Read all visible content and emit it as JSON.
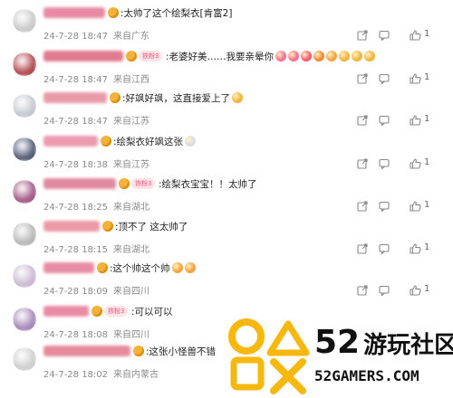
{
  "comments": [
    {
      "text": ":太帅了这个绘梨衣[肯富2]",
      "date": "24-7-28 18:47",
      "location": "来自广东",
      "likes": "1",
      "uname_width": 68,
      "uname_color": "#e88aa3",
      "avatar_color": "#c9c9c9",
      "badge": false,
      "emojis": []
    },
    {
      "text": ":老婆好美……我要亲晕你",
      "date": "24-7-28 18:47",
      "location": "来自江西",
      "likes": "1",
      "uname_width": 88,
      "uname_color": "#e07a8e",
      "avatar_color": "#b24a52",
      "badge": true,
      "badge_label": "铁粉3",
      "emojis": [
        "#ff6f8e",
        "#ff6f8e",
        "#ff5a70",
        "#f08a3a",
        "#f4a340",
        "#f4b43a",
        "#f4b43a",
        "#f4b43a"
      ]
    },
    {
      "text": ":好飒好飒，这直接爱上了",
      "date": "24-7-28 18:47",
      "location": "来自江苏",
      "likes": "1",
      "uname_width": 70,
      "uname_color": "#e99aa9",
      "avatar_color": "#c5c9cf",
      "badge": false,
      "emojis": [
        "#f4b43a"
      ]
    },
    {
      "text": ":绘梨衣好飒这张",
      "date": "24-7-28 18:38",
      "location": "来自江苏",
      "likes": "1",
      "uname_width": 60,
      "uname_color": "#ec9ab0",
      "avatar_color": "#565d7a",
      "badge": false,
      "emojis": [
        "#d9dde2"
      ]
    },
    {
      "text": ":绘梨衣宝宝！！太帅了",
      "date": "24-7-28 18:25",
      "location": "来自湖北",
      "likes": "1",
      "uname_width": 80,
      "uname_color": "#e08aa0",
      "avatar_color": "#a45a86",
      "badge": true,
      "badge_label": "铁粉3",
      "emojis": []
    },
    {
      "text": ":顶不了 这太帅了",
      "date": "24-7-28 18:15",
      "location": "来自湖北",
      "likes": "1",
      "uname_width": 62,
      "uname_color": "#ec9aa6",
      "avatar_color": "#b7b7b7",
      "badge": false,
      "emojis": []
    },
    {
      "text": ":这个帅这个帅",
      "date": "24-7-28 18:09",
      "location": "来自四川",
      "likes": "1",
      "uname_width": 56,
      "uname_color": "#e78da5",
      "avatar_color": "#cab9d2",
      "badge": false,
      "emojis": [
        "#f4a340",
        "#f4a340"
      ]
    },
    {
      "text": ":可以可以",
      "date": "24-7-28 18:08",
      "location": "来自四川",
      "likes": "1",
      "uname_width": 50,
      "uname_color": "#e98ba6",
      "avatar_color": "#a78ab8",
      "badge": true,
      "badge_label": "铁粉3",
      "emojis": []
    },
    {
      "text": ":这张小怪兽不错",
      "date": "24-7-28 18:02",
      "location": "来自内蒙古",
      "likes": "1",
      "uname_width": 96,
      "uname_color": "#e68a9c",
      "avatar_color": "#cfcfcf",
      "badge": false,
      "emojis": []
    }
  ],
  "watermark": {
    "big": "52",
    "cn": "游玩社区",
    "url": "52GAMERS.COM"
  },
  "colors": {
    "pill_bg": "#ffe3e6",
    "text": "#222222",
    "meta": "#8a8a8a"
  }
}
